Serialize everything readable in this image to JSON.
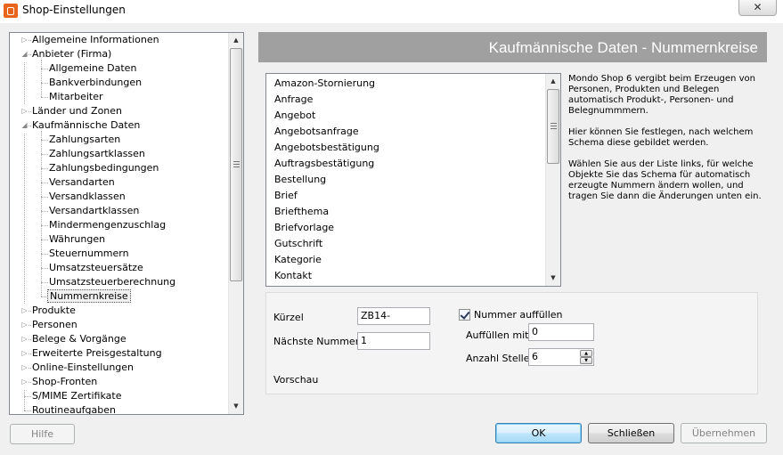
{
  "window": {
    "title": "Shop-Einstellungen",
    "close_label": "✕"
  },
  "tree": {
    "items": [
      {
        "label": "Allgemeine Informationen",
        "level": 0,
        "expander": "closed"
      },
      {
        "label": "Anbieter (Firma)",
        "level": 0,
        "expander": "open"
      },
      {
        "label": "Allgemeine Daten",
        "level": 1,
        "expander": "none"
      },
      {
        "label": "Bankverbindungen",
        "level": 1,
        "expander": "none"
      },
      {
        "label": "Mitarbeiter",
        "level": 1,
        "expander": "none"
      },
      {
        "label": "Länder und Zonen",
        "level": 0,
        "expander": "closed"
      },
      {
        "label": "Kaufmännische Daten",
        "level": 0,
        "expander": "open"
      },
      {
        "label": "Zahlungsarten",
        "level": 1,
        "expander": "none"
      },
      {
        "label": "Zahlungsartklassen",
        "level": 1,
        "expander": "none"
      },
      {
        "label": "Zahlungsbedingungen",
        "level": 1,
        "expander": "none"
      },
      {
        "label": "Versandarten",
        "level": 1,
        "expander": "none"
      },
      {
        "label": "Versandklassen",
        "level": 1,
        "expander": "none"
      },
      {
        "label": "Versandartklassen",
        "level": 1,
        "expander": "none"
      },
      {
        "label": "Mindermengenzuschlag",
        "level": 1,
        "expander": "none"
      },
      {
        "label": "Währungen",
        "level": 1,
        "expander": "none"
      },
      {
        "label": "Steuernummern",
        "level": 1,
        "expander": "none"
      },
      {
        "label": "Umsatzsteuersätze",
        "level": 1,
        "expander": "none"
      },
      {
        "label": "Umsatzsteuerberechnung",
        "level": 1,
        "expander": "none"
      },
      {
        "label": "Nummernkreise",
        "level": 1,
        "expander": "none",
        "selected": true
      },
      {
        "label": "Produkte",
        "level": 0,
        "expander": "closed"
      },
      {
        "label": "Personen",
        "level": 0,
        "expander": "closed"
      },
      {
        "label": "Belege & Vorgänge",
        "level": 0,
        "expander": "closed"
      },
      {
        "label": "Erweiterte Preisgestaltung",
        "level": 0,
        "expander": "closed"
      },
      {
        "label": "Online-Einstellungen",
        "level": 0,
        "expander": "closed"
      },
      {
        "label": "Shop-Fronten",
        "level": 0,
        "expander": "closed"
      },
      {
        "label": "S/MIME Zertifikate",
        "level": 0,
        "expander": "none"
      },
      {
        "label": "Routineaufgaben",
        "level": 0,
        "expander": "none"
      }
    ]
  },
  "header": {
    "title": "Kaufmännische Daten - Nummernkreise"
  },
  "list": {
    "items": [
      "Amazon-Stornierung",
      "Anfrage",
      "Angebot",
      "Angebotsanfrage",
      "Angebotsbestätigung",
      "Auftragsbestätigung",
      "Bestellung",
      "Brief",
      "Briefthema",
      "Briefvorlage",
      "Gutschrift",
      "Kategorie",
      "Kontakt"
    ]
  },
  "description": {
    "p1": "Mondo Shop 6 vergibt beim Erzeugen von Personen, Produkten und Belegen automatisch Produkt-, Personen- und Belegnummmern.",
    "p2": "Hier können Sie festlegen, nach welchem Schema diese gebildet werden.",
    "p3": "Wählen Sie aus der Liste links, für welche Objekte Sie das Schema für automatisch erzeugte Nummern ändern wollen, und tragen Sie dann die Änderungen unten ein."
  },
  "form": {
    "kuerzel_label": "Kürzel",
    "kuerzel_value": "ZB14-",
    "naechste_label": "Nächste Nummer",
    "naechste_value": "1",
    "vorschau_label": "Vorschau",
    "auffuellen_checkbox_label": "Nummer auffüllen",
    "auffuellen_checked": true,
    "auffuellen_mit_label": "Auffüllen mit",
    "auffuellen_mit_value": "0",
    "anzahl_label": "Anzahl Stellen",
    "anzahl_value": "6"
  },
  "buttons": {
    "hilfe": "Hilfe",
    "ok": "OK",
    "schliessen": "Schließen",
    "uebernehmen": "Übernehmen"
  }
}
